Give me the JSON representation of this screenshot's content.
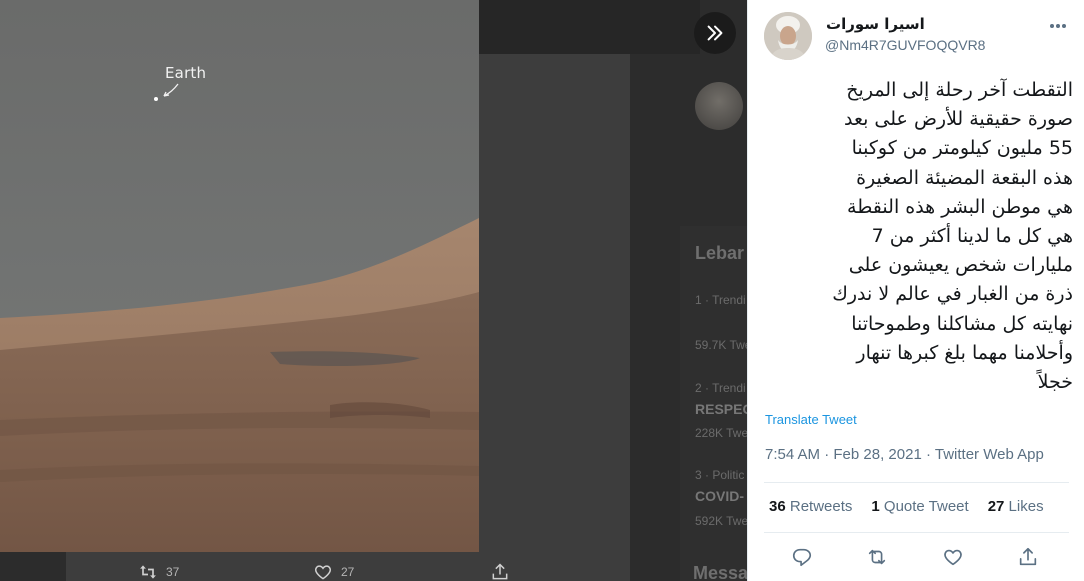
{
  "background_page": {
    "trends_title": "Lebar",
    "trend1_meta": "1 · Trendi",
    "trend1_count": "59.7K Twe",
    "trend2_meta": "2 · Trendi",
    "trend2_name": "RESPEC",
    "trend2_count": "228K Twe",
    "trend3_meta": "3 · Politic",
    "trend3_name": "COVID-",
    "trend3_count": "592K Twe",
    "messages_label": "Messa",
    "retweet_count": "37",
    "like_count": "27"
  },
  "photo": {
    "label": "Earth"
  },
  "tweet": {
    "display_name": "اسيرا سورات",
    "handle": "@Nm4R7GUVFOQQVR8",
    "text": "التقطت آخر رحلة إلى المريخ\nصورة حقيقية للأرض على بعد\n55 مليون كيلومتر من كوكبنا\nهذه البقعة المضيئة الصغيرة\nهي موطن البشر هذه النقطة\nهي كل ما لدينا أكثر من 7\nمليارات شخص يعيشون على\nذرة من الغبار في عالم لا ندرك\nنهايته كل مشاكلنا وطموحاتنا\nوأحلامنا مهما بلغ كبرها تنهار\nخجلاً",
    "translate_label": "Translate Tweet",
    "time": "7:54 AM",
    "date": "Feb 28, 2021",
    "source": "Twitter Web App",
    "retweets_count": "36",
    "retweets_label": "Retweets",
    "quote_count": "1",
    "quote_label": "Quote Tweet",
    "likes_count": "27",
    "likes_label": "Likes"
  },
  "icons": {
    "expand": "double-chevron-right-icon",
    "more": "more-horizontal-icon",
    "reply": "reply-icon",
    "retweet": "retweet-icon",
    "like": "heart-icon",
    "share": "share-icon"
  },
  "colors": {
    "link": "#1b95e0",
    "secondary_text": "#5b7083",
    "primary_text": "#14171a",
    "overlay_bg": "#2c2c2c"
  }
}
